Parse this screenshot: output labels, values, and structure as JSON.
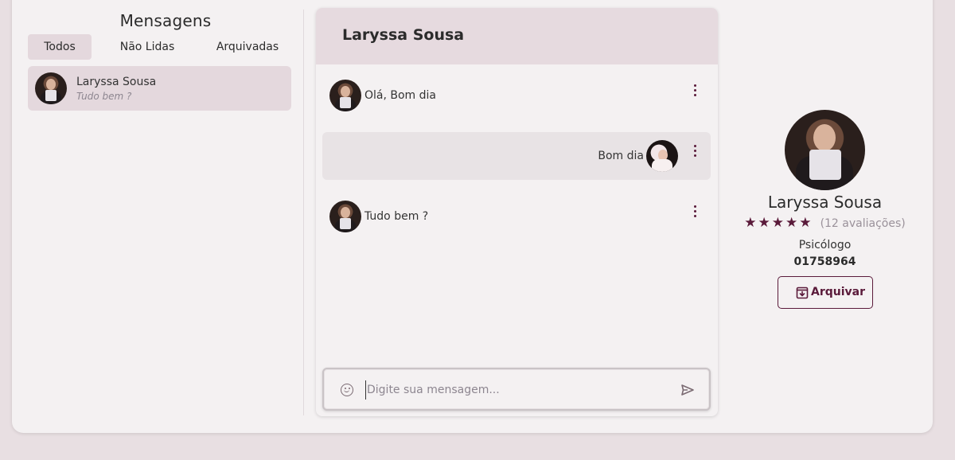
{
  "inbox": {
    "title": "Mensagens",
    "tabs": [
      {
        "label": "Todos",
        "active": true
      },
      {
        "label": "Não Lidas",
        "active": false
      },
      {
        "label": "Arquivadas",
        "active": false
      }
    ],
    "conversations": [
      {
        "name": "Laryssa Sousa",
        "preview": "Tudo bem ?",
        "avatar": "user-avatar"
      }
    ]
  },
  "chat": {
    "title": "Laryssa Sousa",
    "messages": [
      {
        "text": "Olá, Bom dia",
        "sender": "contact"
      },
      {
        "text": "Bom dia",
        "sender": "me"
      },
      {
        "text": "Tudo bem ?",
        "sender": "contact"
      }
    ],
    "composer": {
      "placeholder": "Digite sua mensagem...",
      "emoji_icon": "emoji-icon",
      "send_icon": "send-icon"
    }
  },
  "profile": {
    "name": "Laryssa Sousa",
    "stars": "★★★★★",
    "rating": 5,
    "reviews": "(12 avaliações)",
    "role": "Psicólogo",
    "registration": "01758964",
    "archive_label": "Arquivar",
    "archive_icon": "archive-icon"
  },
  "colors": {
    "accent": "#5a1a3a",
    "background": "#e8dfe2",
    "panel": "#f4f1f2",
    "highlight": "#e4d8dd"
  }
}
